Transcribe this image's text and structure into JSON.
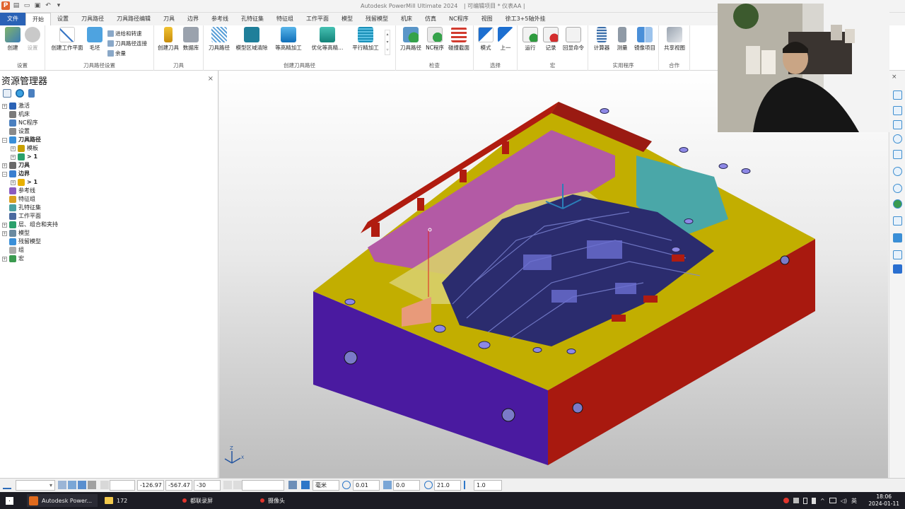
{
  "window": {
    "title": "Autodesk PowerMill Ultimate 2024",
    "project": "| 可编辑项目 * 仪表AA |"
  },
  "menu": {
    "file": "文件",
    "tabs": [
      "开始",
      "设置",
      "刀具路径",
      "刀具路径编辑",
      "刀具",
      "边界",
      "参考线",
      "孔特征集",
      "特征组",
      "工作平面",
      "模型",
      "残留模型",
      "机床",
      "仿真",
      "NC程序",
      "视图",
      "徐工3+5轴外挂"
    ]
  },
  "ribbon": {
    "groups": {
      "setup": "设置",
      "toolpath_setup": "刀具路径设置",
      "tool": "刀具",
      "create_toolpath": "创建刀具路径",
      "check": "检查",
      "select": "选择",
      "macro": "宏",
      "utility": "实用程序",
      "collab": "合作"
    },
    "buttons": {
      "create": "创建",
      "settings": "设置",
      "create_workplane": "创建工作平面",
      "block": "毛坯",
      "feeds_speeds": "进给和转速",
      "toolpath_connect": "刀具路径连接",
      "allowance": "余量",
      "create_tool": "创建刀具",
      "database": "数据库",
      "toolpaths": "刀具路径",
      "model_area_clear": "模型区域清除",
      "const_z_finish": "等高精加工",
      "opt_const_z": "优化等高精...",
      "raster_finish": "平行精加工",
      "toolpath_check": "刀具路径",
      "nc_program": "NC程序",
      "collision_clip": "碰撞截面",
      "mode": "模式",
      "prev": "上一",
      "run": "运行",
      "record": "记录",
      "echo": "回显命令",
      "calculator": "计算器",
      "measure": "测量",
      "mirror": "镜像项目",
      "share_view": "共享视图"
    }
  },
  "explorer": {
    "title": "资源管理器",
    "close": "×",
    "items": [
      {
        "label": "激活",
        "bold": false,
        "indent": 0,
        "expander": "+"
      },
      {
        "label": "机床",
        "bold": false,
        "indent": 0,
        "expander": ""
      },
      {
        "label": "NC程序",
        "bold": false,
        "indent": 0,
        "expander": ""
      },
      {
        "label": "设置",
        "bold": false,
        "indent": 0,
        "expander": ""
      },
      {
        "label": "刀具路径",
        "bold": true,
        "indent": 0,
        "expander": "−"
      },
      {
        "label": "模板",
        "bold": false,
        "indent": 1,
        "expander": "+"
      },
      {
        "label": "> 1",
        "bold": true,
        "indent": 1,
        "expander": "+"
      },
      {
        "label": "刀具",
        "bold": true,
        "indent": 0,
        "expander": "+"
      },
      {
        "label": "边界",
        "bold": true,
        "indent": 0,
        "expander": "−"
      },
      {
        "label": "> 1",
        "bold": true,
        "indent": 1,
        "expander": "+"
      },
      {
        "label": "参考线",
        "bold": false,
        "indent": 0,
        "expander": ""
      },
      {
        "label": "特征组",
        "bold": false,
        "indent": 0,
        "expander": ""
      },
      {
        "label": "孔特征集",
        "bold": false,
        "indent": 0,
        "expander": ""
      },
      {
        "label": "工作平面",
        "bold": false,
        "indent": 0,
        "expander": ""
      },
      {
        "label": "层、组合和夹持",
        "bold": false,
        "indent": 0,
        "expander": "+"
      },
      {
        "label": "模型",
        "bold": false,
        "indent": 0,
        "expander": "+"
      },
      {
        "label": "残留模型",
        "bold": false,
        "indent": 0,
        "expander": ""
      },
      {
        "label": "组",
        "bold": false,
        "indent": 0,
        "expander": ""
      },
      {
        "label": "宏",
        "bold": false,
        "indent": 0,
        "expander": "+"
      }
    ]
  },
  "viewport": {
    "axis_labels": {
      "z": "Z",
      "x": "X",
      "y": "Y"
    }
  },
  "statusbar": {
    "x": "-126.97",
    "y": "-567.47",
    "z": "-30",
    "unit": "毫米",
    "tolerance": "0.01",
    "thickness": "0.0",
    "diameter": "21.0",
    "factor": "1.0"
  },
  "taskbar": {
    "items": [
      "Autodesk Power...",
      "172",
      "都联录屏",
      "摄像头"
    ],
    "ime": "英",
    "time": "18:06",
    "date": "2024-01-11"
  },
  "colors": {
    "accent": "#2a62b6",
    "mold_yellow": "#c8b500",
    "mold_red": "#b01c10",
    "mold_purple": "#4a1aa0",
    "mold_pink": "#b25aa4",
    "mold_cyan": "#4aa7a8"
  }
}
